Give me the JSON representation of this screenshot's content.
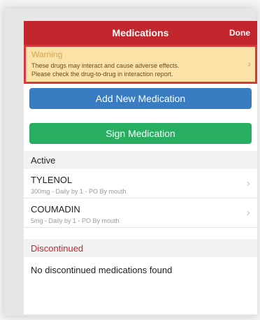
{
  "navbar": {
    "title": "Medications",
    "done_label": "Done"
  },
  "warning": {
    "title": "Warning",
    "line1": "These drugs may interact and cause adverse effects.",
    "line2": "Please check the drug-to-drug in interaction report."
  },
  "buttons": {
    "add_label": "Add New Medication",
    "sign_label": "Sign Medication"
  },
  "sections": {
    "active_title": "Active",
    "discontinued_title": "Discontinued",
    "discontinued_empty": "No discontinued medications found"
  },
  "medications": [
    {
      "name": "TYLENOL",
      "detail": "300mg - Daily by 1 - PO By mouth"
    },
    {
      "name": "COUMADIN",
      "detail": "5mg - Daily by 1 - PO By mouth"
    }
  ],
  "colors": {
    "navbar": "#c1272d",
    "warning_bg": "#fbe3a8",
    "warning_border": "#d8383b",
    "add_button": "#3a7cc1",
    "sign_button": "#27ae60"
  }
}
